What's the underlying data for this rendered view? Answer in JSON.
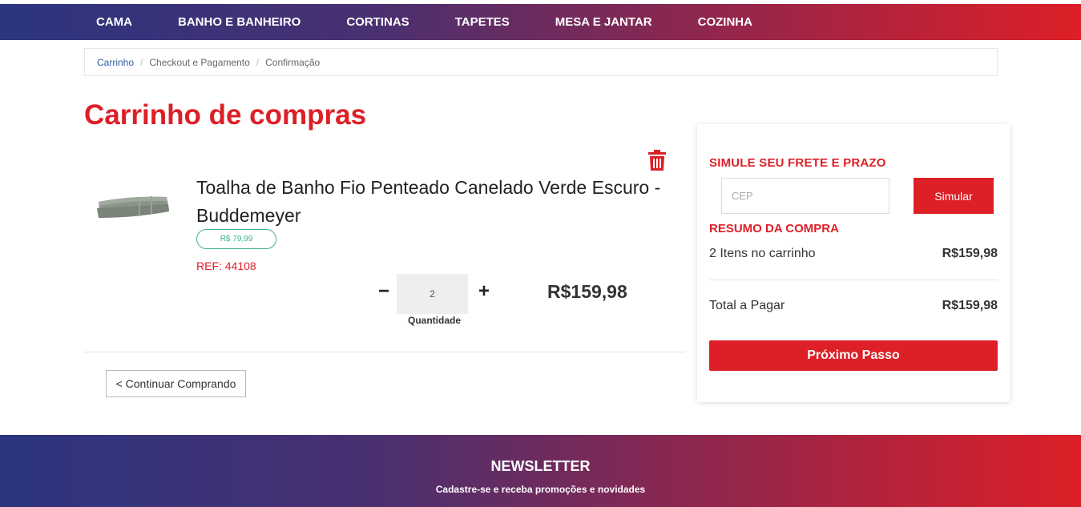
{
  "nav": {
    "items": [
      "CAMA",
      "BANHO E BANHEIRO",
      "CORTINAS",
      "TAPETES",
      "MESA E JANTAR",
      "COZINHA"
    ]
  },
  "breadcrumb": {
    "items": [
      "Carrinho",
      "Checkout e Pagamento",
      "Confirmação"
    ],
    "separator": "/"
  },
  "page": {
    "title": "Carrinho de compras"
  },
  "cart": {
    "item": {
      "name": "Toalha de Banho Fio Penteado Canelado Verde Escuro - Buddemeyer",
      "unit_price": "R$ 79,99",
      "ref": "REF: 44108",
      "quantity": "2",
      "quantity_label": "Quantidade",
      "minus": "−",
      "plus": "+",
      "line_total": "R$159,98",
      "image_color": "#8a9487"
    },
    "continue_label": "< Continuar Comprando",
    "delete_icon": "trash-icon"
  },
  "summary": {
    "shipping_title": "SIMULE SEU FRETE E PRAZO",
    "cep_placeholder": "CEP",
    "simulate_label": "Simular",
    "summary_title": "RESUMO DA COMPRA",
    "items_label": "2 Itens no carrinho",
    "items_value": "R$159,98",
    "total_label": "Total a Pagar",
    "total_value": "R$159,98",
    "next_label": "Próximo Passo"
  },
  "newsletter": {
    "title": "NEWSLETTER",
    "subtitle": "Cadastre-se e receba promoções e novidades"
  },
  "colors": {
    "accent": "#dd1f27",
    "gradient_start": "#2b3580",
    "badge_green": "#3bb586",
    "link_blue": "#2c5aa0"
  }
}
